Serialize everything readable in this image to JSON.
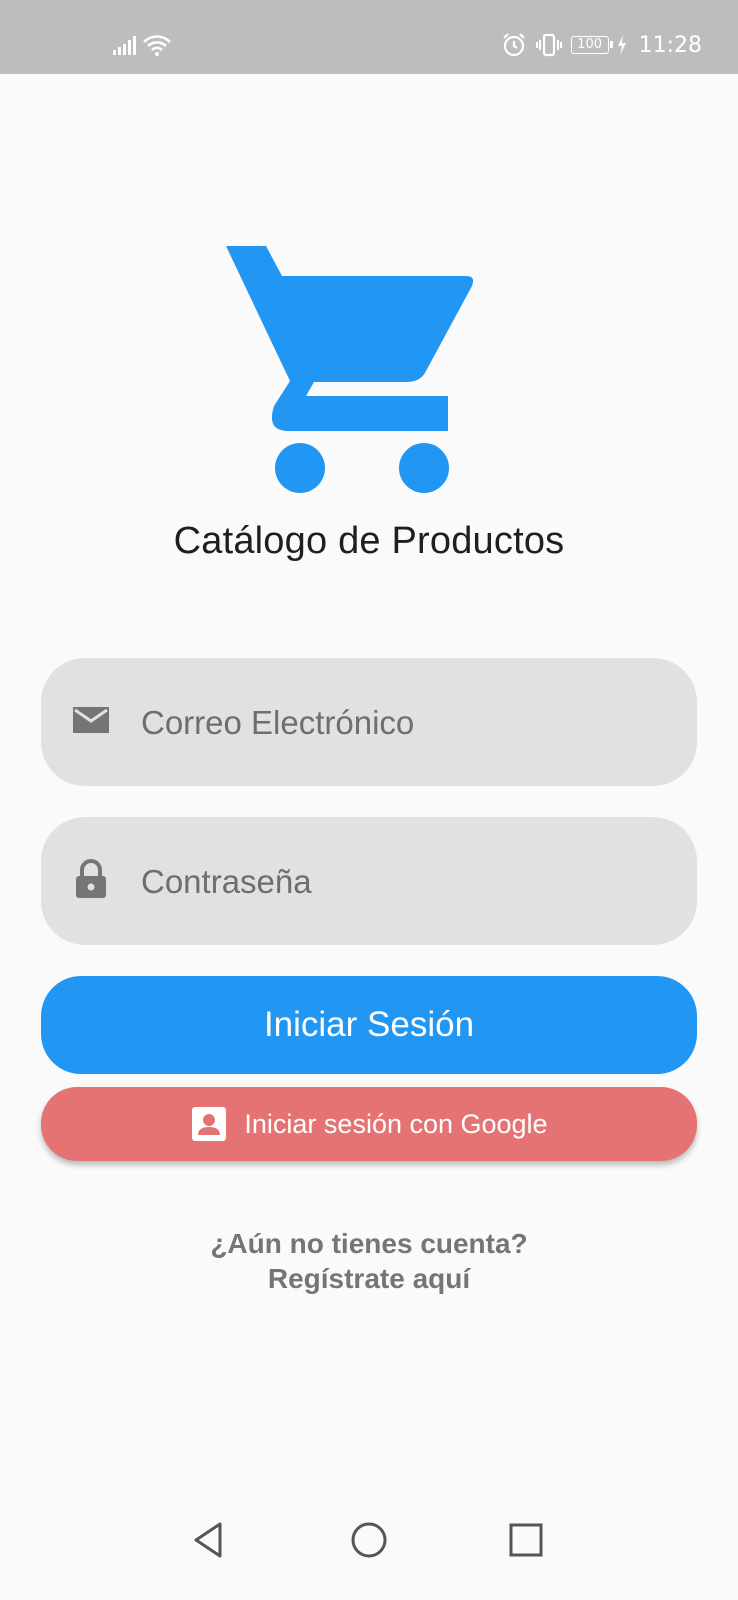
{
  "status_bar": {
    "time": "11:28",
    "battery": "100",
    "icons": [
      "signal-icon",
      "wifi-icon",
      "alarm-icon",
      "vibrate-icon",
      "battery-icon",
      "charging-icon"
    ]
  },
  "app": {
    "logo_icon": "shopping-cart-icon",
    "title": "Catálogo de Productos",
    "accent_color": "#2196f3"
  },
  "form": {
    "email": {
      "placeholder": "Correo Electrónico",
      "value": "",
      "icon": "mail-icon"
    },
    "password": {
      "placeholder": "Contraseña",
      "value": "",
      "icon": "lock-icon"
    },
    "login_button_label": "Iniciar Sesión",
    "google_button": {
      "label": "Iniciar sesión con Google",
      "icon": "account-box-icon",
      "color": "#e57373"
    }
  },
  "register": {
    "line1": "¿Aún no tienes cuenta?",
    "line2": "Regístrate aquí"
  },
  "nav_bar": {
    "icons": [
      "back-icon",
      "home-icon",
      "recents-icon"
    ]
  }
}
